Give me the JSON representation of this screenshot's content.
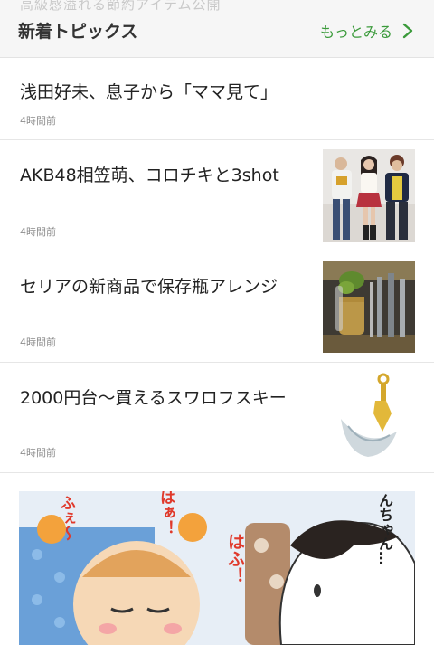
{
  "header": {
    "ghost_text": "高級感溢れる節約アイテム公開",
    "title": "新着トピックス",
    "more_label": "もっとみる"
  },
  "topics": [
    {
      "title": "浅田好未、息子から「ママ見て」",
      "time": "4時間前",
      "has_thumb": false
    },
    {
      "title": "AKB48相笠萌、コロチキと3shot",
      "time": "4時間前",
      "has_thumb": true,
      "thumb_icon": "group-photo-image"
    },
    {
      "title": "セリアの新商品で保存瓶アレンジ",
      "time": "4時間前",
      "has_thumb": true,
      "thumb_icon": "kitchen-jar-image"
    },
    {
      "title": "2000円台〜買えるスワロフスキー",
      "time": "4時間前",
      "has_thumb": true,
      "thumb_icon": "earring-image"
    }
  ],
  "banner": {
    "speech_left": "ふぇ〜",
    "speech_mid": "はぁ！",
    "speech_right": "はふ！",
    "speech_far": "んちゃん…"
  },
  "colors": {
    "accent": "#3a9a3a",
    "header_bg": "#f6f6f6",
    "time_text": "#8c8c8c"
  }
}
